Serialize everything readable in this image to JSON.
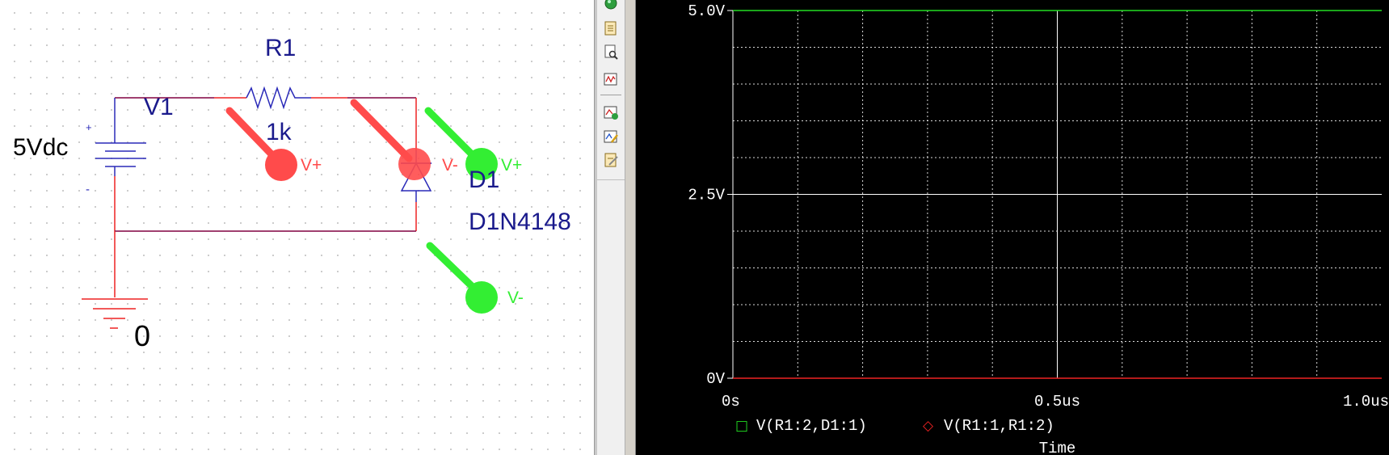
{
  "schematic": {
    "r1": {
      "name": "R1",
      "value": "1k"
    },
    "v1": {
      "name": "V1",
      "value": "5Vdc",
      "plus": "+",
      "minus": "-"
    },
    "d1": {
      "name": "D1",
      "value": "D1N4148"
    },
    "ground": {
      "label": "0"
    },
    "markers": {
      "red_vplus": "V+",
      "red_vminus": "V-",
      "green_vplus": "V+",
      "green_vminus": "V-"
    },
    "colors": {
      "wire": "#ee2222",
      "wire_top": "#800040",
      "part": "#2a2ab8",
      "red_marker": "#ff4b4b",
      "green_marker": "#33ee33"
    }
  },
  "toolbar": {
    "icons": [
      "run-icon",
      "document-icon",
      "document-search-icon",
      "waveform-icon",
      "add-trace-icon",
      "edit-trace-icon",
      "notes-icon"
    ]
  },
  "probe": {
    "colors": {
      "background": "#000000",
      "grid": "#ffffff",
      "series1": "#22dd22",
      "series2": "#ee2222"
    },
    "chart_data": {
      "type": "line",
      "xlabel": "Time",
      "ylabel": "",
      "xlim": [
        0,
        1.0
      ],
      "ylim": [
        0,
        5.0
      ],
      "x_ticks": [
        "0s",
        "0.5us",
        "1.0us"
      ],
      "y_ticks": [
        "5.0V",
        "2.5V",
        "0V"
      ],
      "grid": true,
      "legend_position": "bottom-left",
      "series": [
        {
          "name": "V(R1:2,D1:1)",
          "marker": "□",
          "color": "#22dd22",
          "x": [
            0,
            1.0
          ],
          "y": [
            5.0,
            5.0
          ]
        },
        {
          "name": "V(R1:1,R1:2)",
          "marker": "◇",
          "color": "#ee2222",
          "x": [
            0,
            1.0
          ],
          "y": [
            0,
            0
          ]
        }
      ]
    }
  }
}
